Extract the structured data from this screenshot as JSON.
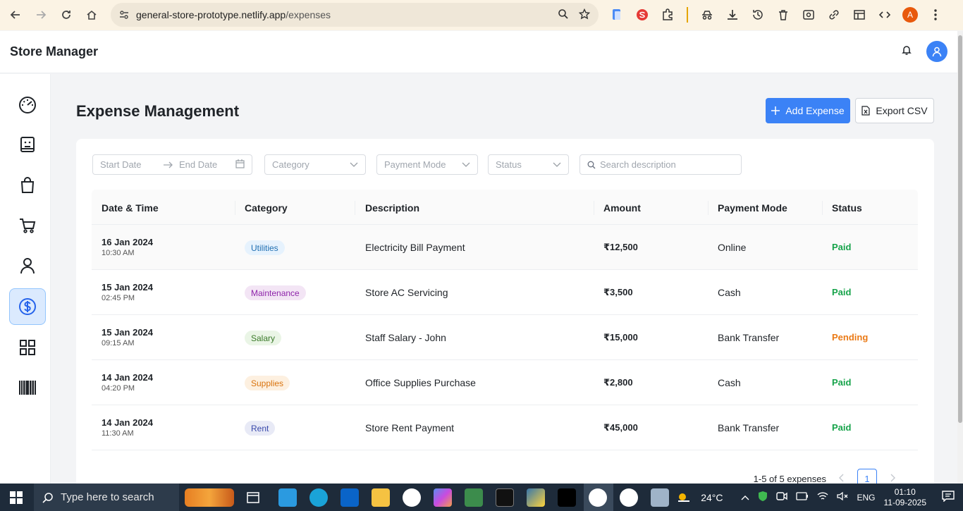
{
  "browser": {
    "url_host": "general-store-prototype.netlify.app",
    "url_path": "/expenses",
    "profile_initial": "A"
  },
  "app": {
    "title": "Store Manager"
  },
  "page": {
    "title": "Expense Management",
    "add_button": "Add Expense",
    "export_button": "Export CSV"
  },
  "filters": {
    "start_date": "Start Date",
    "end_date": "End Date",
    "category": "Category",
    "payment_mode": "Payment Mode",
    "status": "Status",
    "search": "Search description"
  },
  "table": {
    "headers": [
      "Date & Time",
      "Category",
      "Description",
      "Amount",
      "Payment Mode",
      "Status"
    ],
    "rows": [
      {
        "date": "16 Jan 2024",
        "time": "10:30 AM",
        "category": "Utilities",
        "description": "Electricity Bill Payment",
        "amount": "₹12,500",
        "mode": "Online",
        "status": "Paid"
      },
      {
        "date": "15 Jan 2024",
        "time": "02:45 PM",
        "category": "Maintenance",
        "description": "Store AC Servicing",
        "amount": "₹3,500",
        "mode": "Cash",
        "status": "Paid"
      },
      {
        "date": "15 Jan 2024",
        "time": "09:15 AM",
        "category": "Salary",
        "description": "Staff Salary - John",
        "amount": "₹15,000",
        "mode": "Bank Transfer",
        "status": "Pending"
      },
      {
        "date": "14 Jan 2024",
        "time": "04:20 PM",
        "category": "Supplies",
        "description": "Office Supplies Purchase",
        "amount": "₹2,800",
        "mode": "Cash",
        "status": "Paid"
      },
      {
        "date": "14 Jan 2024",
        "time": "11:30 AM",
        "category": "Rent",
        "description": "Store Rent Payment",
        "amount": "₹45,000",
        "mode": "Bank Transfer",
        "status": "Paid"
      }
    ]
  },
  "pagination": {
    "summary": "1-5 of 5 expenses",
    "current_page": "1"
  },
  "taskbar": {
    "search_placeholder": "Type here to search",
    "temperature": "24°C",
    "language": "ENG",
    "time": "01:10",
    "date": "11-09-2025"
  },
  "colors": {
    "accent": "#3b82f6",
    "paid": "#16a34a",
    "pending": "#ea7a16"
  }
}
